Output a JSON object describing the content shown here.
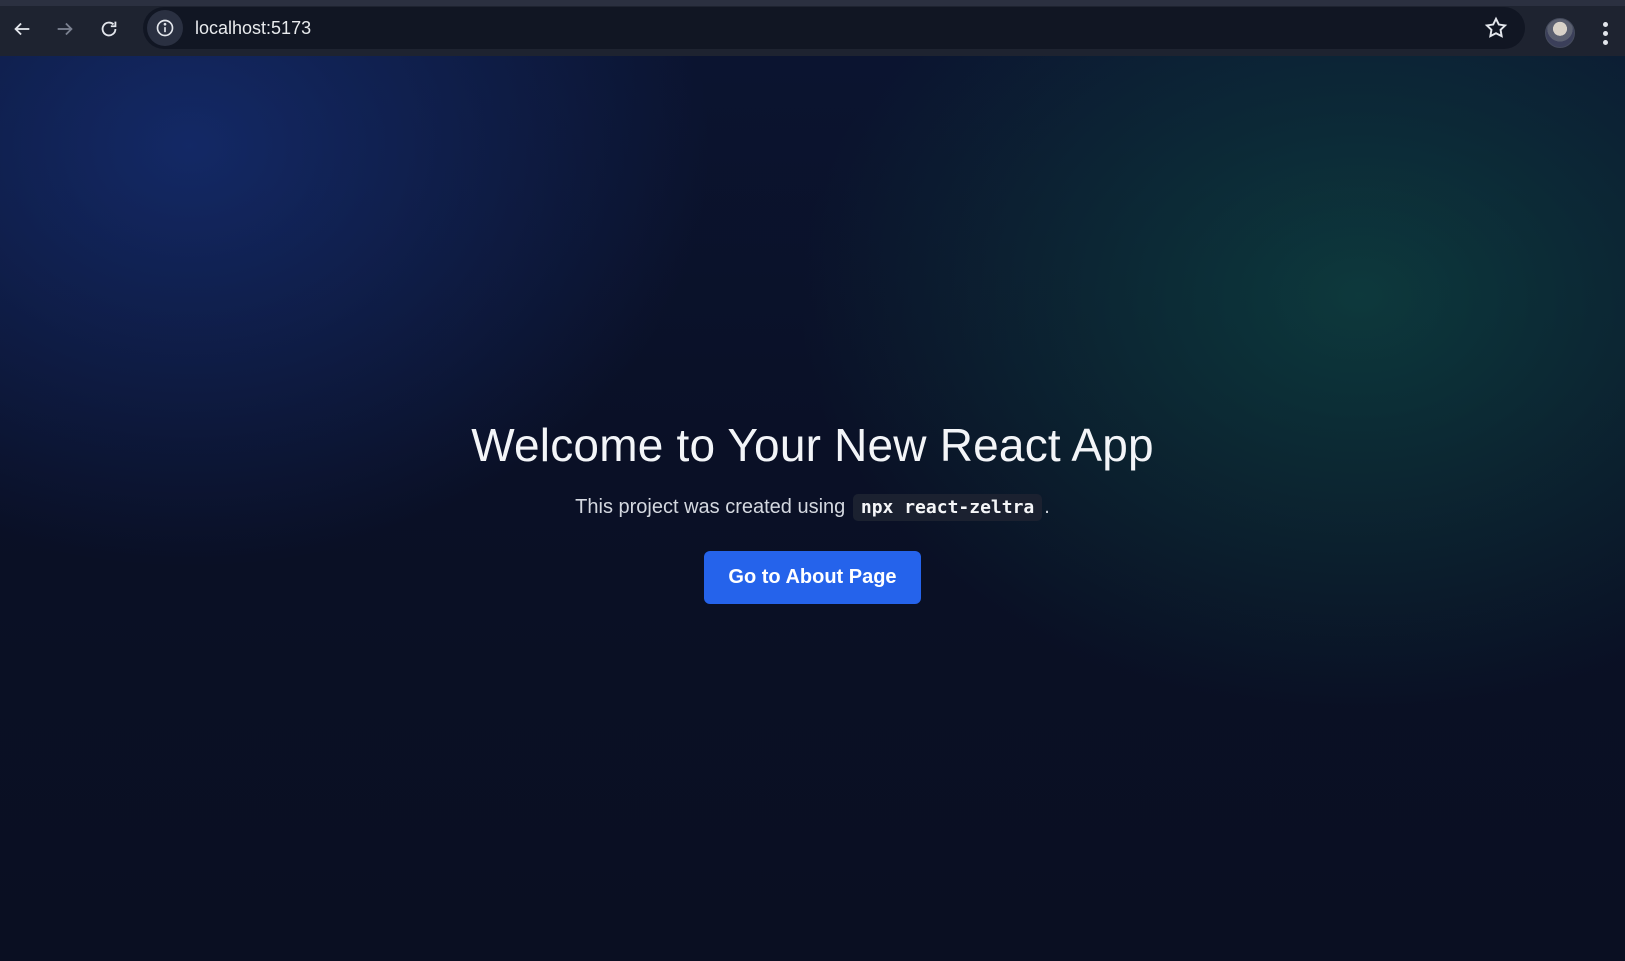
{
  "browser": {
    "url": "localhost:5173",
    "icons": {
      "back": "back-arrow-icon",
      "forward": "forward-arrow-icon",
      "reload": "reload-icon",
      "site_info": "info-icon",
      "bookmark": "star-icon",
      "profile": "avatar",
      "menu": "more-vert-icon"
    }
  },
  "page": {
    "title": "Welcome to Your New React App",
    "subtitle_prefix": "This project was created using",
    "subtitle_code": "npx react-zeltra",
    "subtitle_suffix": ".",
    "button_label": "Go to About Page"
  },
  "colors": {
    "button": "#2563eb",
    "background": "#0b1022"
  }
}
